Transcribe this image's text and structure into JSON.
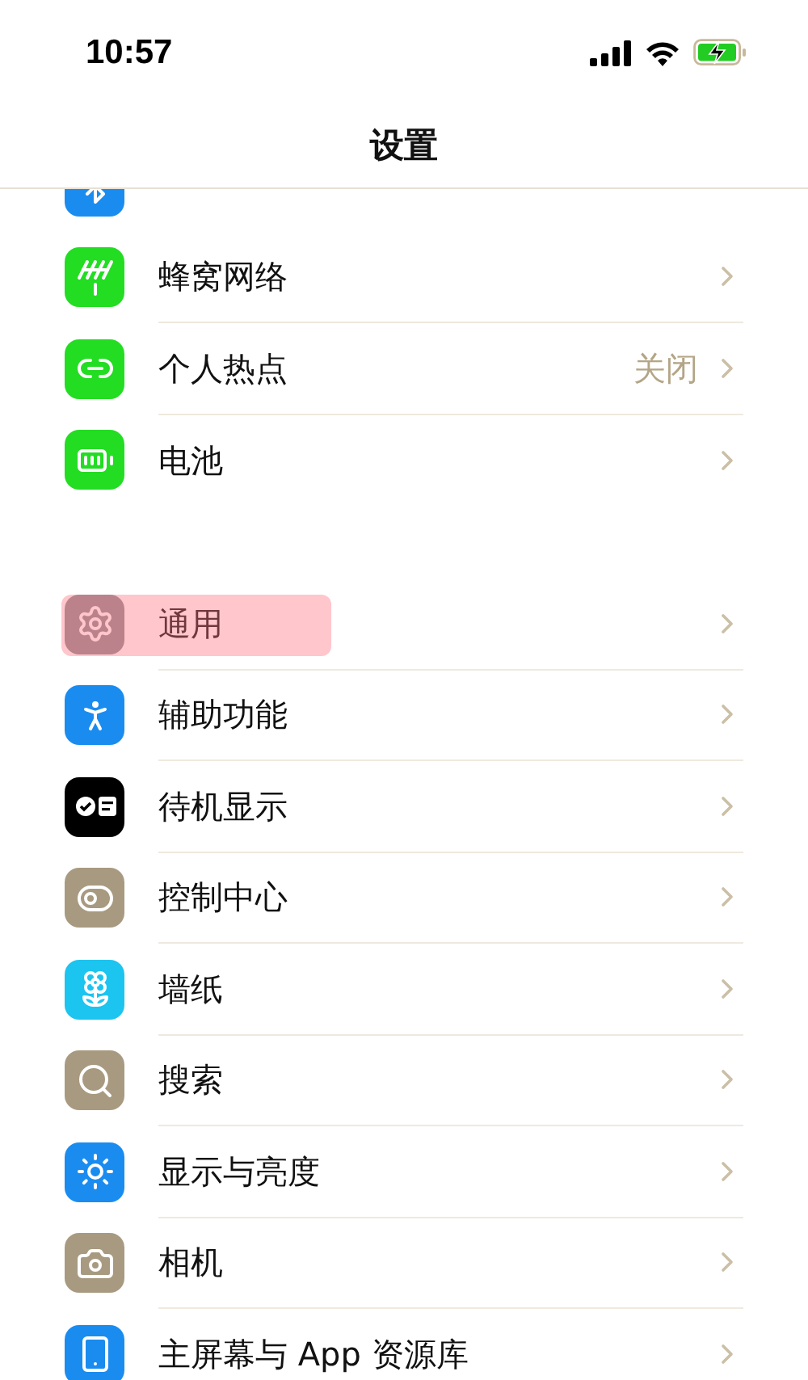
{
  "status_bar": {
    "time": "10:57"
  },
  "header": {
    "title": "设置"
  },
  "groups": [
    {
      "items": [
        {
          "kind": "bluetooth",
          "highlighted": false
        },
        {
          "kind": "cellular",
          "label": "蜂窝网络",
          "highlighted": false
        },
        {
          "kind": "hotspot",
          "label": "个人热点",
          "value": "关闭",
          "highlighted": false
        },
        {
          "kind": "battery",
          "label": "电池",
          "highlighted": false
        }
      ]
    },
    {
      "items": [
        {
          "kind": "general",
          "label": "通用",
          "highlighted": true
        },
        {
          "kind": "accessibility",
          "label": "辅助功能",
          "highlighted": false
        },
        {
          "kind": "standby",
          "label": "待机显示",
          "highlighted": false
        },
        {
          "kind": "control",
          "label": "控制中心",
          "highlighted": false
        },
        {
          "kind": "wallpaper",
          "label": "墙纸",
          "highlighted": false
        },
        {
          "kind": "search",
          "label": "搜索",
          "highlighted": false
        },
        {
          "kind": "display",
          "label": "显示与亮度",
          "highlighted": false
        },
        {
          "kind": "camera",
          "label": "相机",
          "highlighted": false
        },
        {
          "kind": "homescreen",
          "label": "主屏幕与 App 资源库",
          "highlighted": false
        }
      ]
    }
  ]
}
